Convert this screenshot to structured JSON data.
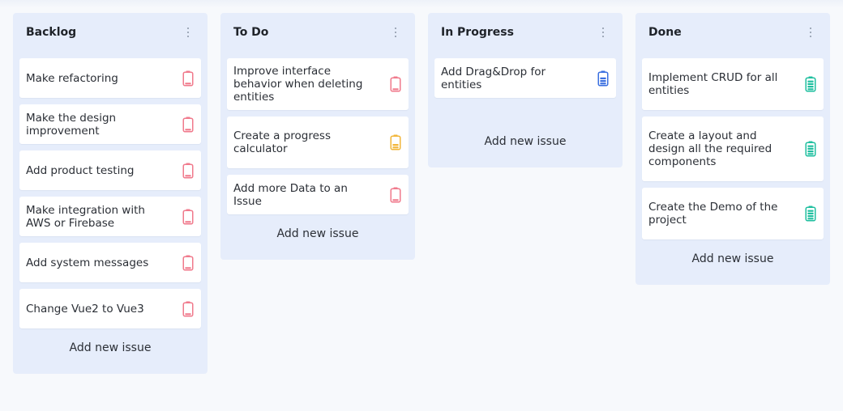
{
  "colors": {
    "page_bg": "#f7f9fc",
    "column_bg": "#e6edfb",
    "card_bg": "#ffffff",
    "priority_high": "#f07a8c",
    "priority_medium": "#f2b63a",
    "priority_low": "#3a6fe0",
    "priority_done": "#1fbf9f"
  },
  "columns": [
    {
      "title": "Backlog",
      "add_label": "Add new issue",
      "cards": [
        {
          "text": "Make refactoring",
          "icon": "battery-low-icon",
          "color": "#f07a8c"
        },
        {
          "text": "Make the design improvement",
          "icon": "battery-low-icon",
          "color": "#f07a8c"
        },
        {
          "text": "Add product testing",
          "icon": "battery-low-icon",
          "color": "#f07a8c"
        },
        {
          "text": "Make integration with AWS or Firebase",
          "icon": "battery-low-icon",
          "color": "#f07a8c"
        },
        {
          "text": "Add system messages",
          "icon": "battery-low-icon",
          "color": "#f07a8c"
        },
        {
          "text": "Change Vue2 to Vue3",
          "icon": "battery-low-icon",
          "color": "#f07a8c"
        }
      ]
    },
    {
      "title": "To Do",
      "add_label": "Add new issue",
      "cards": [
        {
          "text": "Improve interface behavior when deleting entities",
          "icon": "battery-low-icon",
          "color": "#f07a8c"
        },
        {
          "text": "Create a progress calculator",
          "icon": "battery-medium-icon",
          "color": "#f2b63a"
        },
        {
          "text": "Add more Data to an Issue",
          "icon": "battery-low-icon",
          "color": "#f07a8c"
        }
      ]
    },
    {
      "title": "In Progress",
      "add_label": "Add new issue",
      "cards": [
        {
          "text": "Add Drag&Drop for entities",
          "icon": "battery-high-icon",
          "color": "#3a6fe0"
        }
      ]
    },
    {
      "title": "Done",
      "add_label": "Add new issue",
      "cards": [
        {
          "text": "Implement CRUD for all entities",
          "icon": "battery-full-icon",
          "color": "#1fbf9f"
        },
        {
          "text": "Create a layout and design all the required components",
          "icon": "battery-full-icon",
          "color": "#1fbf9f"
        },
        {
          "text": "Create the Demo of the project",
          "icon": "battery-full-icon",
          "color": "#1fbf9f"
        }
      ]
    }
  ]
}
